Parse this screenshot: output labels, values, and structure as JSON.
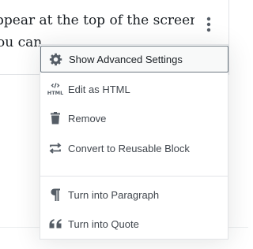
{
  "editor": {
    "paragraph_line_1": "ppear at the top of the screen",
    "paragraph_line_2": "ou can"
  },
  "more_menu": {
    "button_icon": "more-vertical-icon",
    "items": [
      {
        "label": "Show Advanced Settings",
        "icon": "gear-icon",
        "active": true
      },
      {
        "label": "Edit as HTML",
        "icon": "html-icon"
      },
      {
        "label": "Remove",
        "icon": "trash-icon"
      },
      {
        "label": "Convert to Reusable Block",
        "icon": "convert-icon"
      },
      {
        "label": "Turn into Paragraph",
        "icon": "paragraph-icon"
      },
      {
        "label": "Turn into Quote",
        "icon": "quote-icon"
      }
    ]
  },
  "colors": {
    "text": "#191e23",
    "menu_text": "#40464d",
    "icon": "#555d66",
    "border": "#e2e4e7",
    "active_border": "#6c7781"
  }
}
